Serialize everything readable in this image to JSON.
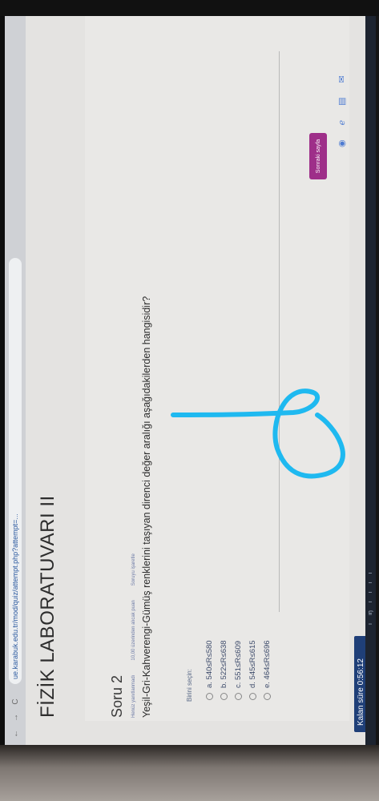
{
  "browser": {
    "nav": {
      "back": "←",
      "forward": "→",
      "reload": "C"
    },
    "url": "ue.karabuk.edu.tr/mod/quiz/attempt.php?attempt=..."
  },
  "page": {
    "title": "FİZİK LABORATUVARI II"
  },
  "question": {
    "number": "Soru 2",
    "meta": [
      "Henüz yanıtlanmadı",
      "10,00 üzerinden alıcak puan",
      "Soruyu işaretle"
    ],
    "text": "Yeşil-Gri-Kahverengi-Gümüş renklerini taşıyan direnci değer aralığı aşağıdakilerden hangisidir?",
    "choose_label": "Birini seçin:",
    "options": [
      {
        "label": "a. 540≤R≤580"
      },
      {
        "label": "b. 522≤R≤638"
      },
      {
        "label": "c. 551≤R≤609"
      },
      {
        "label": "d. 545≤R≤615"
      },
      {
        "label": "e. 464≤R≤696"
      }
    ],
    "next_button": "Sonraki sayfa"
  },
  "timer": {
    "label": "Kalan süre 0:56:12"
  },
  "taskbar": {
    "items": [
      "ı",
      "ıŋ",
      "ı",
      "ı",
      "ı",
      "ı"
    ]
  },
  "colors": {
    "accent": "#9e2f89",
    "scribble": "#1fb9f0",
    "timer_bg": "#1f3f78"
  },
  "side_icons": [
    "chrome-icon",
    "edge-icon",
    "file-icon",
    "mail-icon"
  ]
}
